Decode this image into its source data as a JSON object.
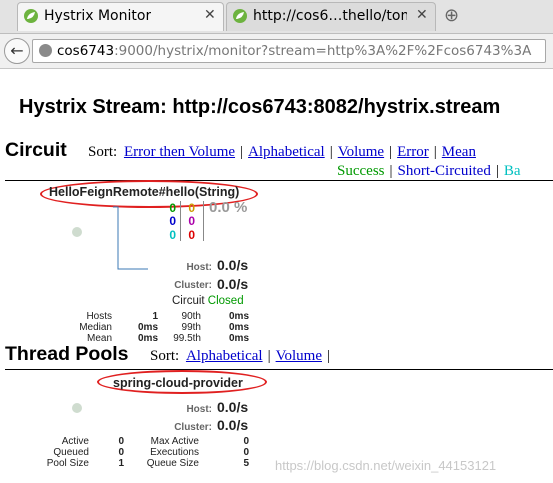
{
  "browser": {
    "tabs": [
      {
        "title": "Hystrix Monitor",
        "close": "✕"
      },
      {
        "title": "http://cos6…thello/tom",
        "close": "✕"
      }
    ],
    "new_tab": "⊕",
    "back": "←",
    "url_host": "cos6743",
    "url_rest": ":9000/hystrix/monitor?stream=http%3A%2F%2Fcos6743%3A"
  },
  "page": {
    "title": "Hystrix Stream: http://cos6743:8082/hystrix.stream"
  },
  "circuit": {
    "heading": "Circuit",
    "sort_label": "Sort:",
    "sort_links": [
      "Error then Volume",
      "Alphabetical",
      "Volume",
      "Error",
      "Mean"
    ],
    "status_links": [
      "Success",
      "Short-Circuited",
      "Ba"
    ],
    "colors": {
      "success": "#009900",
      "short_circuited": "#0000cc",
      "bad_request": "#00c0c0",
      "timeout": "#cc9900",
      "rejected": "#aa00aa",
      "failure": "#dd0000"
    },
    "card": {
      "name": "HelloFeignRemote#hello(String)",
      "counts_left": [
        "0",
        "0",
        "0"
      ],
      "counts_right": [
        "0",
        "0",
        "0"
      ],
      "error_pct": "0.0 %",
      "host_label": "Host:",
      "host_rate": "0.0/s",
      "cluster_label": "Cluster:",
      "cluster_rate": "0.0/s",
      "circuit_label": "Circuit",
      "circuit_status": "Closed",
      "stats": [
        [
          "Hosts",
          "1",
          "90th",
          "0ms"
        ],
        [
          "Median",
          "0ms",
          "99th",
          "0ms"
        ],
        [
          "Mean",
          "0ms",
          "99.5th",
          "0ms"
        ]
      ]
    }
  },
  "threadpools": {
    "heading": "Thread Pools",
    "sort_label": "Sort:",
    "sort_links": [
      "Alphabetical",
      "Volume"
    ],
    "card": {
      "name": "spring-cloud-provider",
      "host_label": "Host:",
      "host_rate": "0.0/s",
      "cluster_label": "Cluster:",
      "cluster_rate": "0.0/s",
      "stats": [
        [
          "Active",
          "0",
          "Max Active",
          "0"
        ],
        [
          "Queued",
          "0",
          "Executions",
          "0"
        ],
        [
          "Pool Size",
          "1",
          "Queue Size",
          "5"
        ]
      ]
    }
  },
  "watermark": "https://blog.csdn.net/weixin_44153121"
}
